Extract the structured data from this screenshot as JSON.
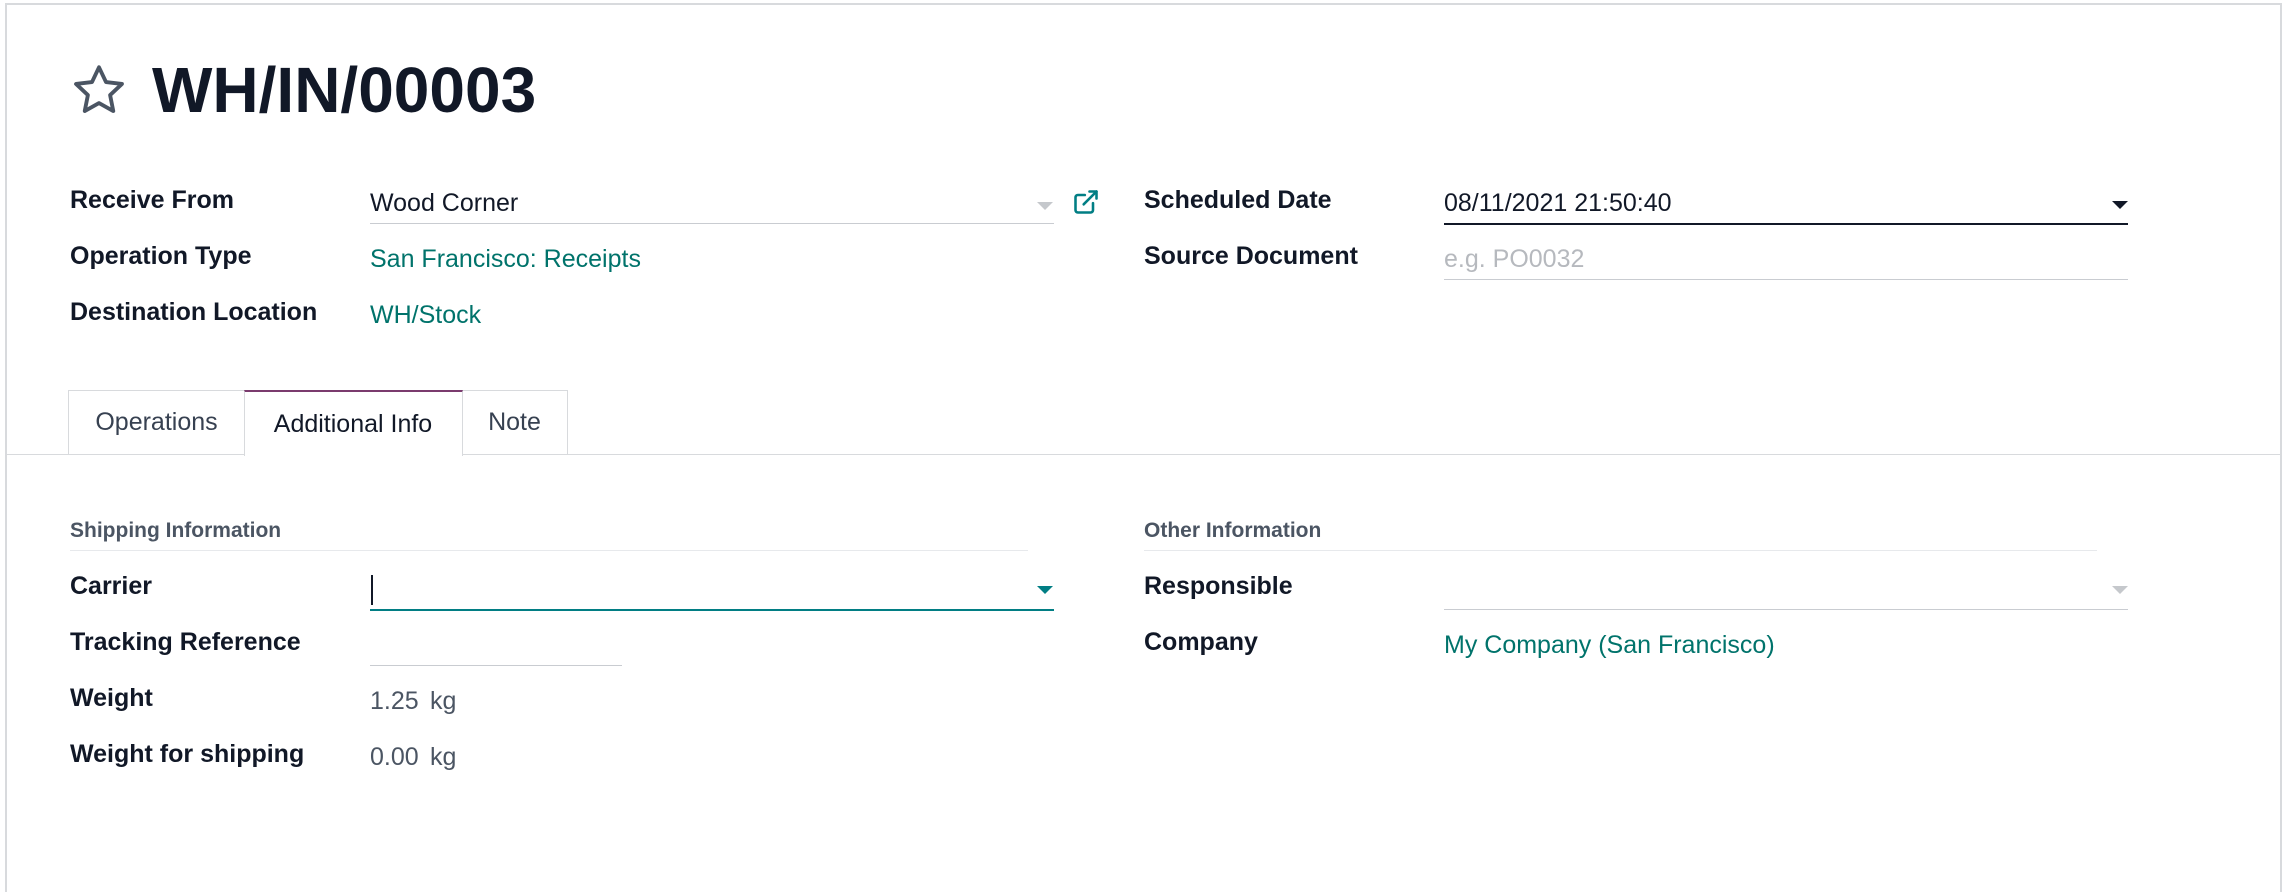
{
  "record": {
    "title": "WH/IN/00003"
  },
  "form_left": {
    "receive_from": {
      "label": "Receive From",
      "value": "Wood Corner"
    },
    "operation_type": {
      "label": "Operation Type",
      "value": "San Francisco: Receipts"
    },
    "destination_location": {
      "label": "Destination Location",
      "value": "WH/Stock"
    }
  },
  "form_right": {
    "scheduled_date": {
      "label": "Scheduled Date",
      "value": "08/11/2021 21:50:40"
    },
    "source_document": {
      "label": "Source Document",
      "value": "",
      "placeholder": "e.g. PO0032"
    }
  },
  "tabs": [
    {
      "label": "Operations",
      "active": false
    },
    {
      "label": "Additional Info",
      "active": true
    },
    {
      "label": "Note",
      "active": false
    }
  ],
  "shipping_information": {
    "title": "Shipping Information",
    "carrier": {
      "label": "Carrier",
      "value": ""
    },
    "tracking_reference": {
      "label": "Tracking Reference",
      "value": ""
    },
    "weight": {
      "label": "Weight",
      "value": "1.25",
      "unit": "kg"
    },
    "weight_for_shipping": {
      "label": "Weight for shipping",
      "value": "0.00",
      "unit": "kg"
    }
  },
  "other_information": {
    "title": "Other Information",
    "responsible": {
      "label": "Responsible",
      "value": ""
    },
    "company": {
      "label": "Company",
      "value": "My Company (San Francisco)"
    }
  },
  "colors": {
    "link": "#00736b",
    "active_tab_accent": "#7b3b6e",
    "border": "#d8dadd"
  },
  "icons": {
    "favorite": "star-outline-icon",
    "external": "external-link-icon",
    "dropdown": "caret-down-icon"
  }
}
